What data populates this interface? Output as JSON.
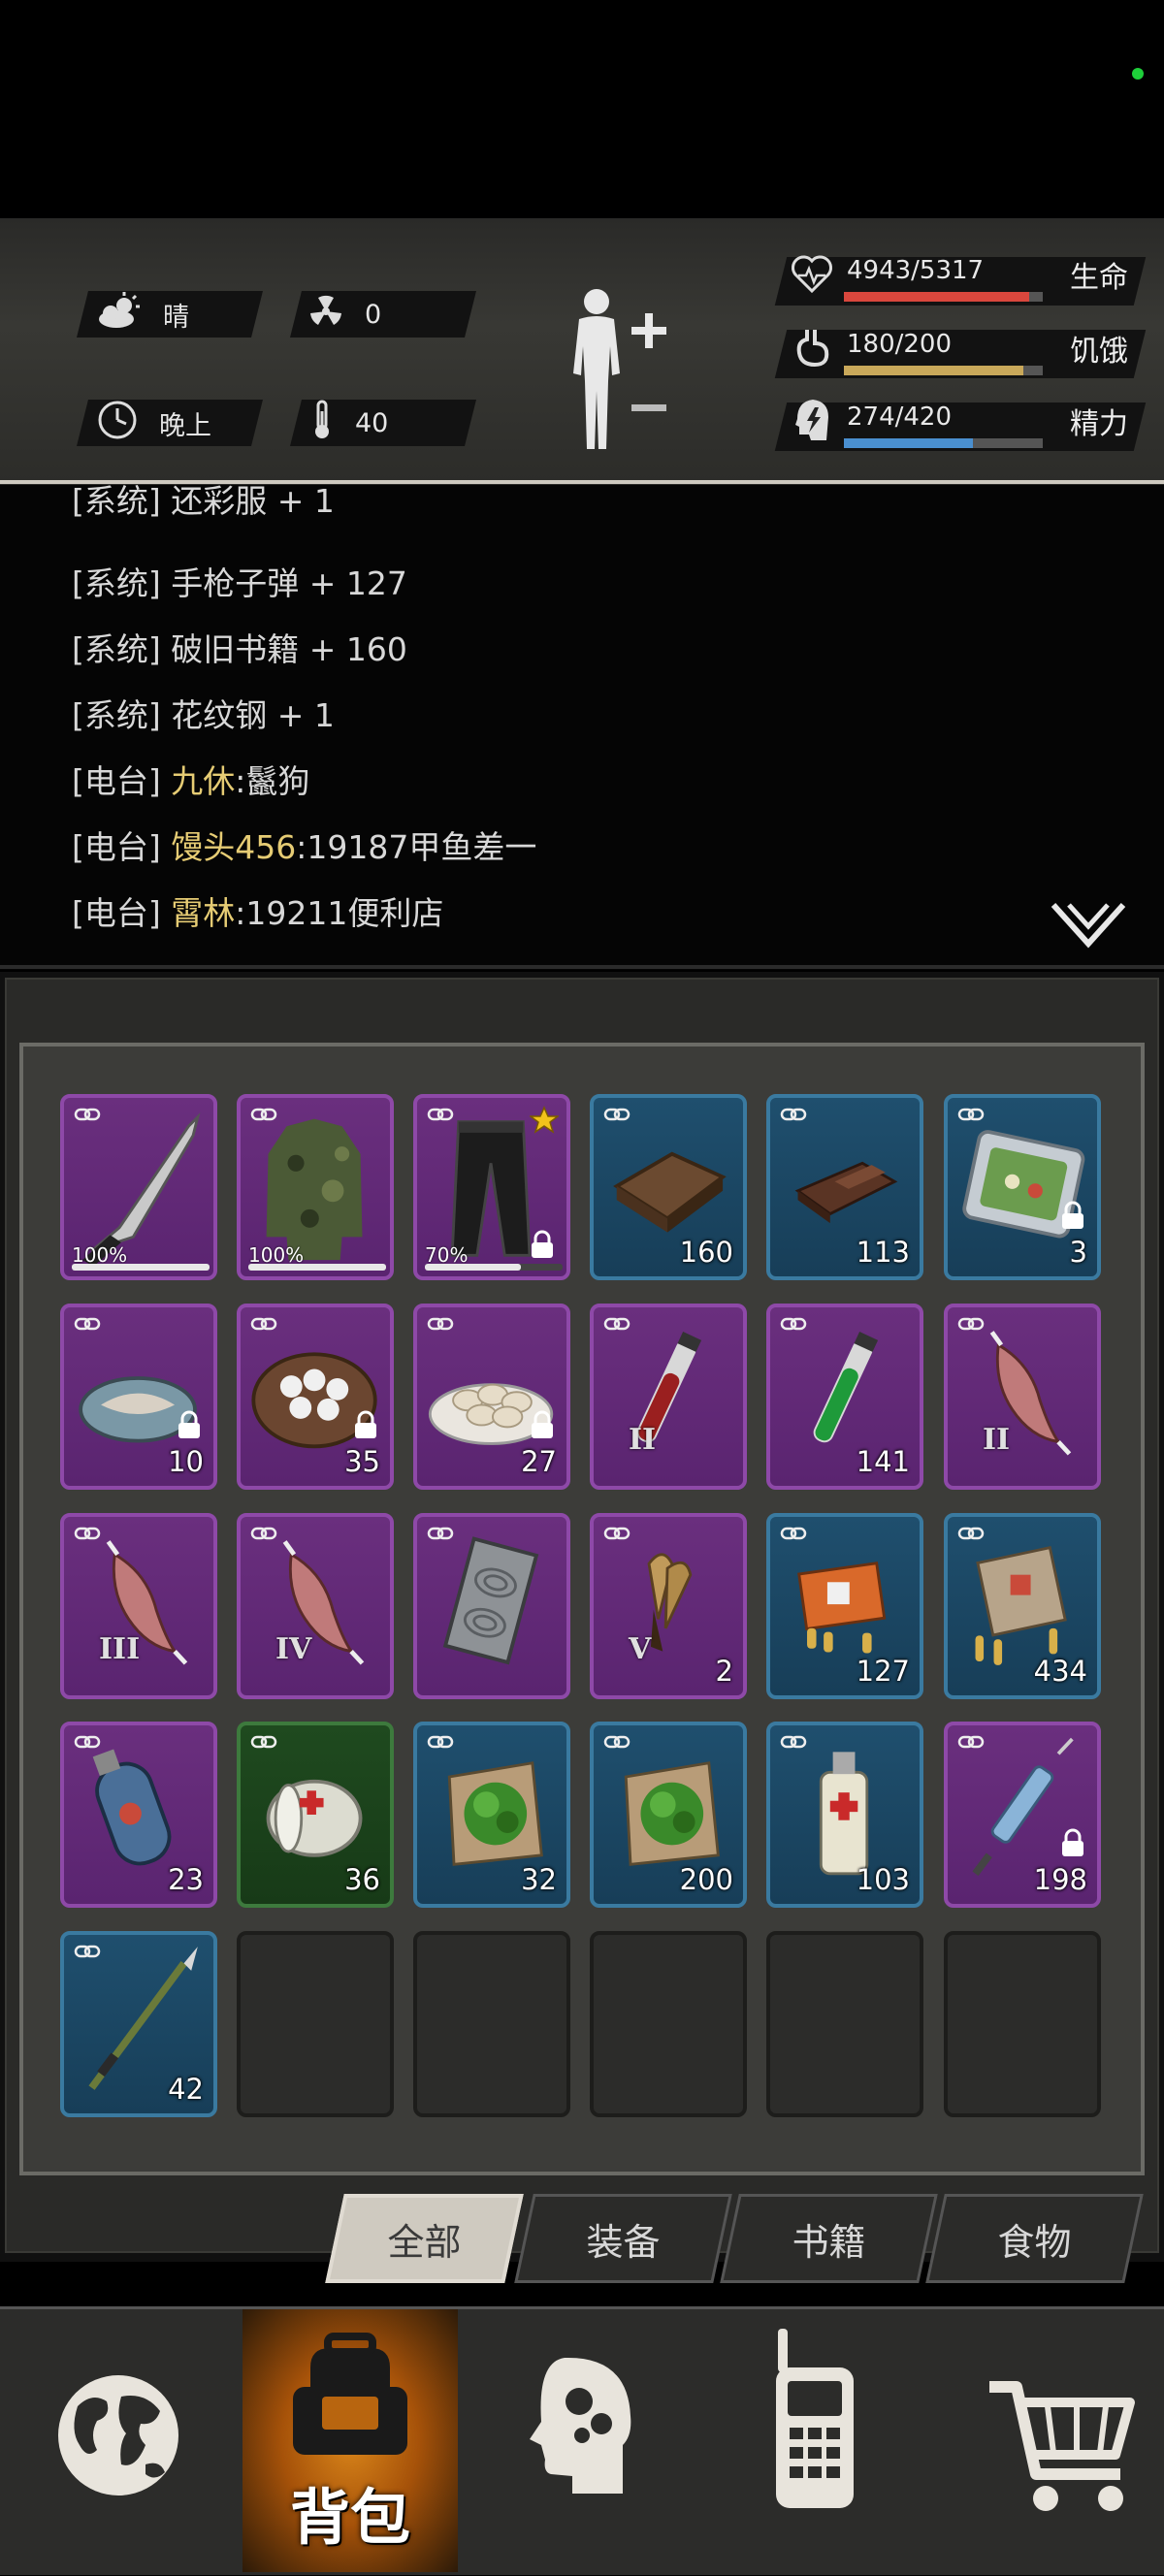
{
  "hud": {
    "weather_label": "晴",
    "radiation_value": "0",
    "time_label": "晚上",
    "temperature_value": "40",
    "stats": [
      {
        "value": "4943/5317",
        "label": "生命",
        "fill": 0.93,
        "color": "#d9473d"
      },
      {
        "value": "180/200",
        "label": "饥饿",
        "fill": 0.9,
        "color": "#c9a85a"
      },
      {
        "value": "274/420",
        "label": "精力",
        "fill": 0.65,
        "color": "#4a8fcf"
      }
    ]
  },
  "log": [
    {
      "tag": "[系统]",
      "name": "",
      "text": "还彩服 + 1"
    },
    {
      "tag": "[系统]",
      "name": "",
      "text": "手枪子弹 + 127"
    },
    {
      "tag": "[系统]",
      "name": "",
      "text": "破旧书籍 + 160"
    },
    {
      "tag": "[系统]",
      "name": "",
      "text": "花纹钢 + 1"
    },
    {
      "tag": "[电台]",
      "name": "九休",
      "text": ":鬣狗"
    },
    {
      "tag": "[电台]",
      "name": "馒头456",
      "text": ":19187甲鱼差一"
    },
    {
      "tag": "[电台]",
      "name": "霄林",
      "text": ":19211便利店"
    }
  ],
  "inventory": [
    {
      "rarity": "purple",
      "icon": "machete-icon",
      "durability": "100%",
      "dur": 1.0
    },
    {
      "rarity": "purple",
      "icon": "camo-jacket-icon",
      "durability": "100%",
      "dur": 1.0
    },
    {
      "rarity": "purple",
      "icon": "pants-icon",
      "durability": "70%",
      "dur": 0.7,
      "star": true,
      "lock": true
    },
    {
      "rarity": "blue",
      "icon": "old-book-icon",
      "qty": "160"
    },
    {
      "rarity": "blue",
      "icon": "chocolate-icon",
      "qty": "113"
    },
    {
      "rarity": "blue",
      "icon": "lunchbox-icon",
      "qty": "3",
      "lock": true
    },
    {
      "rarity": "purple",
      "icon": "fish-plate-icon",
      "qty": "10",
      "lock": true
    },
    {
      "rarity": "purple",
      "icon": "eggs-bowl-icon",
      "qty": "35",
      "lock": true
    },
    {
      "rarity": "purple",
      "icon": "dumplings-icon",
      "qty": "27",
      "lock": true
    },
    {
      "rarity": "purple",
      "icon": "red-vial-icon",
      "level": "II"
    },
    {
      "rarity": "purple",
      "icon": "green-vial-icon",
      "qty": "141"
    },
    {
      "rarity": "purple",
      "icon": "meat-icon",
      "level": "II"
    },
    {
      "rarity": "purple",
      "icon": "meat-icon",
      "level": "III"
    },
    {
      "rarity": "purple",
      "icon": "meat-icon",
      "level": "IV"
    },
    {
      "rarity": "purple",
      "icon": "damascus-steel-icon"
    },
    {
      "rarity": "purple",
      "icon": "claws-icon",
      "level": "V",
      "qty": "2"
    },
    {
      "rarity": "blue",
      "icon": "pistol-ammo-icon",
      "qty": "127"
    },
    {
      "rarity": "blue",
      "icon": "rifle-ammo-icon",
      "qty": "434"
    },
    {
      "rarity": "purple",
      "icon": "gas-canister-icon",
      "qty": "23"
    },
    {
      "rarity": "green",
      "icon": "bandage-icon",
      "qty": "36"
    },
    {
      "rarity": "blue",
      "icon": "herb-icon",
      "qty": "32"
    },
    {
      "rarity": "blue",
      "icon": "herb-icon",
      "qty": "200"
    },
    {
      "rarity": "blue",
      "icon": "spray-icon",
      "qty": "103"
    },
    {
      "rarity": "purple",
      "icon": "syringe-icon",
      "qty": "198",
      "lock": true
    },
    {
      "rarity": "blue",
      "icon": "spear-icon",
      "qty": "42"
    },
    {
      "rarity": "empty"
    },
    {
      "rarity": "empty"
    },
    {
      "rarity": "empty"
    },
    {
      "rarity": "empty"
    },
    {
      "rarity": "empty"
    }
  ],
  "tabs": [
    "全部",
    "装备",
    "书籍",
    "食物"
  ],
  "nav": {
    "active_label": "背包",
    "items": [
      "globe-icon",
      "backpack-icon",
      "skills-head-icon",
      "radio-icon",
      "shop-cart-icon"
    ]
  }
}
